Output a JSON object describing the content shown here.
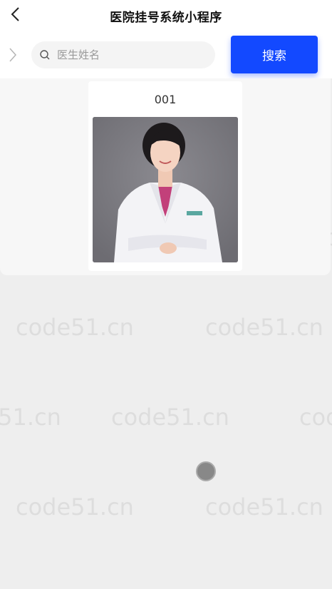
{
  "nav": {
    "title": "医院挂号系统小程序"
  },
  "search": {
    "placeholder": "医生姓名",
    "value": "",
    "button_label": "搜索"
  },
  "doctors": [
    {
      "name": "001"
    }
  ],
  "watermark_text": "code51.cn",
  "colors": {
    "accent": "#1349ff",
    "background": "#eeeeee"
  }
}
